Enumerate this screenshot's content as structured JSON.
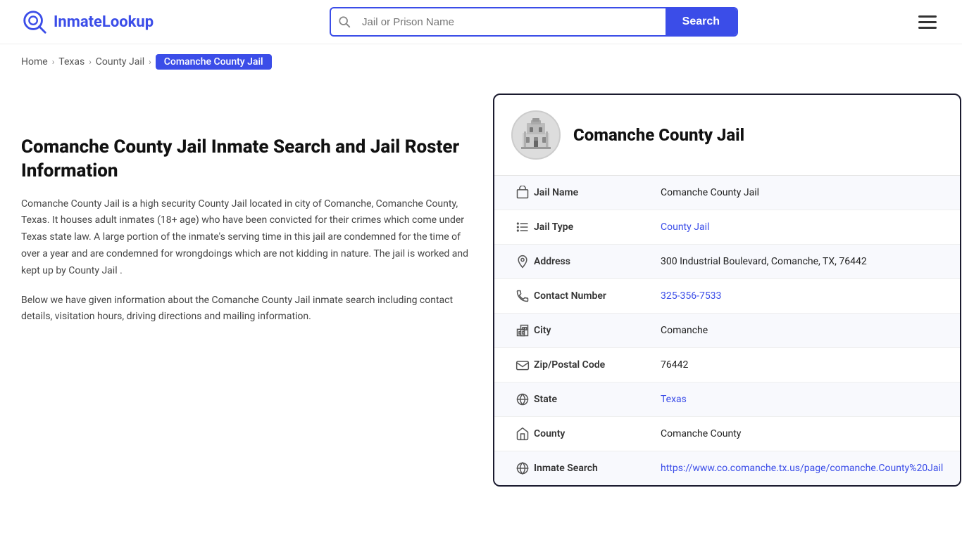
{
  "header": {
    "logo_text_normal": "Inmate",
    "logo_text_accent": "Lookup",
    "search_placeholder": "Jail or Prison Name",
    "search_button_label": "Search",
    "menu_label": "Menu"
  },
  "breadcrumb": {
    "items": [
      {
        "label": "Home",
        "href": "#"
      },
      {
        "label": "Texas",
        "href": "#"
      },
      {
        "label": "County Jail",
        "href": "#"
      },
      {
        "label": "Comanche County Jail",
        "current": true
      }
    ]
  },
  "left": {
    "title": "Comanche County Jail Inmate Search and Jail Roster Information",
    "desc1": "Comanche County Jail is a high security County Jail located in city of Comanche, Comanche County, Texas. It houses adult inmates (18+ age) who have been convicted for their crimes which come under Texas state law. A large portion of the inmate's serving time in this jail are condemned for the time of over a year and are condemned for wrongdoings which are not kidding in nature. The jail is worked and kept up by County Jail .",
    "desc2": "Below we have given information about the Comanche County Jail inmate search including contact details, visitation hours, driving directions and mailing information."
  },
  "card": {
    "title": "Comanche County Jail",
    "rows": [
      {
        "icon": "building-icon",
        "label": "Jail Name",
        "value": "Comanche County Jail",
        "link": null
      },
      {
        "icon": "list-icon",
        "label": "Jail Type",
        "value": "County Jail",
        "link": "#"
      },
      {
        "icon": "pin-icon",
        "label": "Address",
        "value": "300 Industrial Boulevard, Comanche, TX, 76442",
        "link": null
      },
      {
        "icon": "phone-icon",
        "label": "Contact Number",
        "value": "325-356-7533",
        "link": "tel:325-356-7533"
      },
      {
        "icon": "city-icon",
        "label": "City",
        "value": "Comanche",
        "link": null
      },
      {
        "icon": "mail-icon",
        "label": "Zip/Postal Code",
        "value": "76442",
        "link": null
      },
      {
        "icon": "globe-icon",
        "label": "State",
        "value": "Texas",
        "link": "#"
      },
      {
        "icon": "county-icon",
        "label": "County",
        "value": "Comanche County",
        "link": null
      },
      {
        "icon": "search-globe-icon",
        "label": "Inmate Search",
        "value": "https://www.co.comanche.tx.us/page/comanche.County%20Jail",
        "link": "https://www.co.comanche.tx.us/page/comanche.County%20Jail"
      }
    ]
  },
  "colors": {
    "accent": "#3b4de8",
    "dark": "#1a1a2e"
  }
}
